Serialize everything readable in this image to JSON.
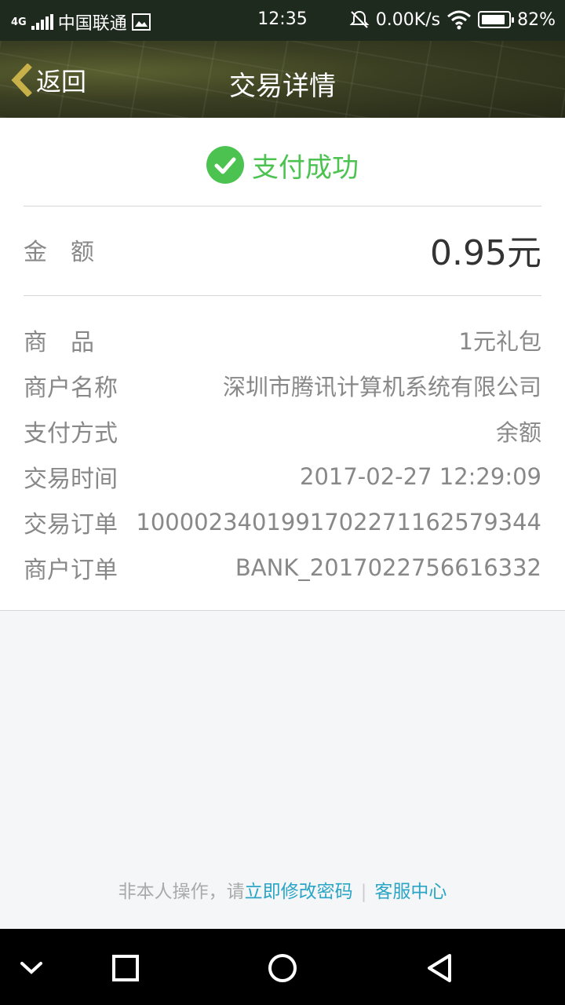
{
  "status_bar": {
    "network": "4G",
    "carrier": "中国联通",
    "time": "12:35",
    "speed": "0.00K/s",
    "battery": "82%",
    "battery_level": 0.82
  },
  "nav": {
    "back_label": "返回",
    "title": "交易详情"
  },
  "payment": {
    "status_label": "支付成功",
    "status_color": "#4cc350",
    "amount_label": "金额",
    "amount_value": "0.95元"
  },
  "details": [
    {
      "label": "商　品",
      "value": "1元礼包"
    },
    {
      "label": "商户名称",
      "value": "深圳市腾讯计算机系统有限公司"
    },
    {
      "label": "支付方式",
      "value": "余额"
    },
    {
      "label": "交易时间",
      "value": "2017-02-27 12:29:09"
    },
    {
      "label": "交易订单",
      "value": "100002340199170227116257934​4"
    },
    {
      "label": "商户订单",
      "value": "BANK_2017022756616332"
    }
  ],
  "footer": {
    "prefix": "非本人操作，请",
    "change_password": "立即修改密码",
    "separator": "|",
    "support": "客服中心",
    "link_color": "#2ba5c6"
  },
  "system_nav": {
    "icons": [
      "chevron-down-icon",
      "recent-apps-icon",
      "home-icon",
      "back-icon"
    ]
  }
}
